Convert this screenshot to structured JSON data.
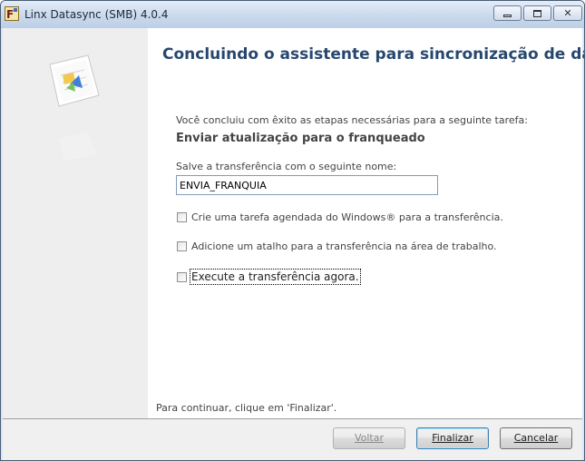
{
  "window": {
    "title": "Linx Datasync (SMB) 4.0.4"
  },
  "wizard": {
    "heading": "Concluindo o assistente para sincronização de dados",
    "intro": "Você concluiu com êxito as etapas necessárias para a seguinte tarefa:",
    "task_name": "Enviar atualização para o franqueado",
    "save_label": "Salve a transferência com o seguinte nome:",
    "save_value": "ENVIA_FRANQUIA",
    "options": [
      {
        "label": "Crie uma tarefa agendada do Windows® para a transferência.",
        "checked": false
      },
      {
        "label": "Adicione um atalho para a transferência na área de trabalho.",
        "checked": false
      },
      {
        "label": "Execute a transferência agora.",
        "checked": false
      }
    ],
    "footer_hint": "Para continuar, clique em 'Finalizar'."
  },
  "buttons": {
    "back": "Voltar",
    "finish": "Finalizar",
    "cancel": "Cancelar"
  },
  "colors": {
    "heading": "#27476f",
    "sidebar": "#eeeeef",
    "titlebar": "#cad9ec"
  }
}
